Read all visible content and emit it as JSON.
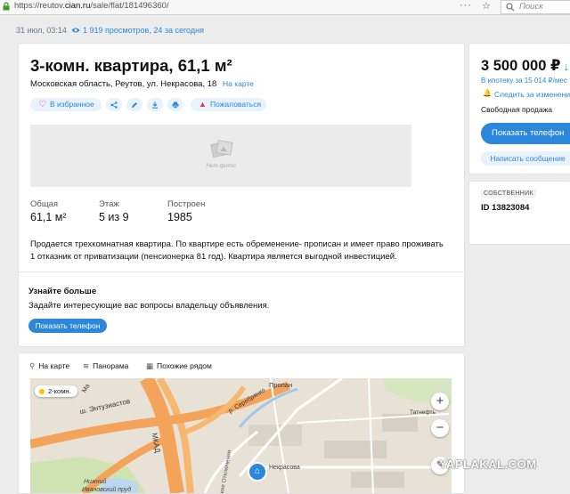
{
  "browser": {
    "url_prefix": "https://reutov.",
    "url_domain": "cian.ru",
    "url_path": "/sale/flat/181496360/",
    "menu_label": "···",
    "search_placeholder": "Поиск"
  },
  "meta": {
    "date": "31 июл, 03:14",
    "views": "1 919 просмотров, 24 за сегодня"
  },
  "listing": {
    "title": "3-комн. квартира, 61,1 м²",
    "address": "Московская область, Реутов, ул. Некрасова, 18",
    "map_link": "На карте",
    "actions": {
      "favorite": "В избранное",
      "report": "Пожаловаться"
    },
    "photo_placeholder": "Нет фото",
    "facts": [
      {
        "label": "Общая",
        "value": "61,1 м²"
      },
      {
        "label": "Этаж",
        "value": "5 из 9"
      },
      {
        "label": "Построен",
        "value": "1985"
      }
    ],
    "description": "Продается трехкомнатная квартира. По квартире есть обременение- прописан и имеет право проживать 1 отказник от приватизации (пенсионерка 81 год). Квартира является выгодной инвестицией."
  },
  "learn_more": {
    "heading": "Узнайте больше",
    "subtext": "Задайте интересующие вас вопросы владельцу объявления.",
    "button": "Показать телефон"
  },
  "sidebar": {
    "price": "3 500 000 ₽",
    "mortgage": "В ипотеку за 15 014 ₽/мес",
    "follow": "Следить за изменени",
    "sale_type": "Свободная продажа",
    "phone_button": "Показать телефон",
    "message_button": "Написать сообщение"
  },
  "owner": {
    "badge": "СОБСТВЕННИК",
    "id": "ID 13823084"
  },
  "map": {
    "tabs": [
      "На карте",
      "Панорама",
      "Похожие рядом"
    ],
    "rooms_badge": "2-комн.",
    "zoom_in": "+",
    "zoom_out": "−",
    "labels": {
      "entuziastov": "ш. Энтузиастов",
      "mkad": "МКАД",
      "propan": "Пропан",
      "serebryanko": "р. Серебрянко",
      "tatneft": "Татнефть",
      "ma": "Ма",
      "nizhny": "Нижний",
      "ivanovsky": "Ивановский пруд",
      "nekrasova": "Некрасова",
      "ochakovskaya": "Утовские Отключения"
    }
  },
  "watermark": "YAPLAKAL.COM",
  "colors": {
    "accent": "#2b87db",
    "price_drop": "#2aa952",
    "heart": "#e0365e"
  }
}
